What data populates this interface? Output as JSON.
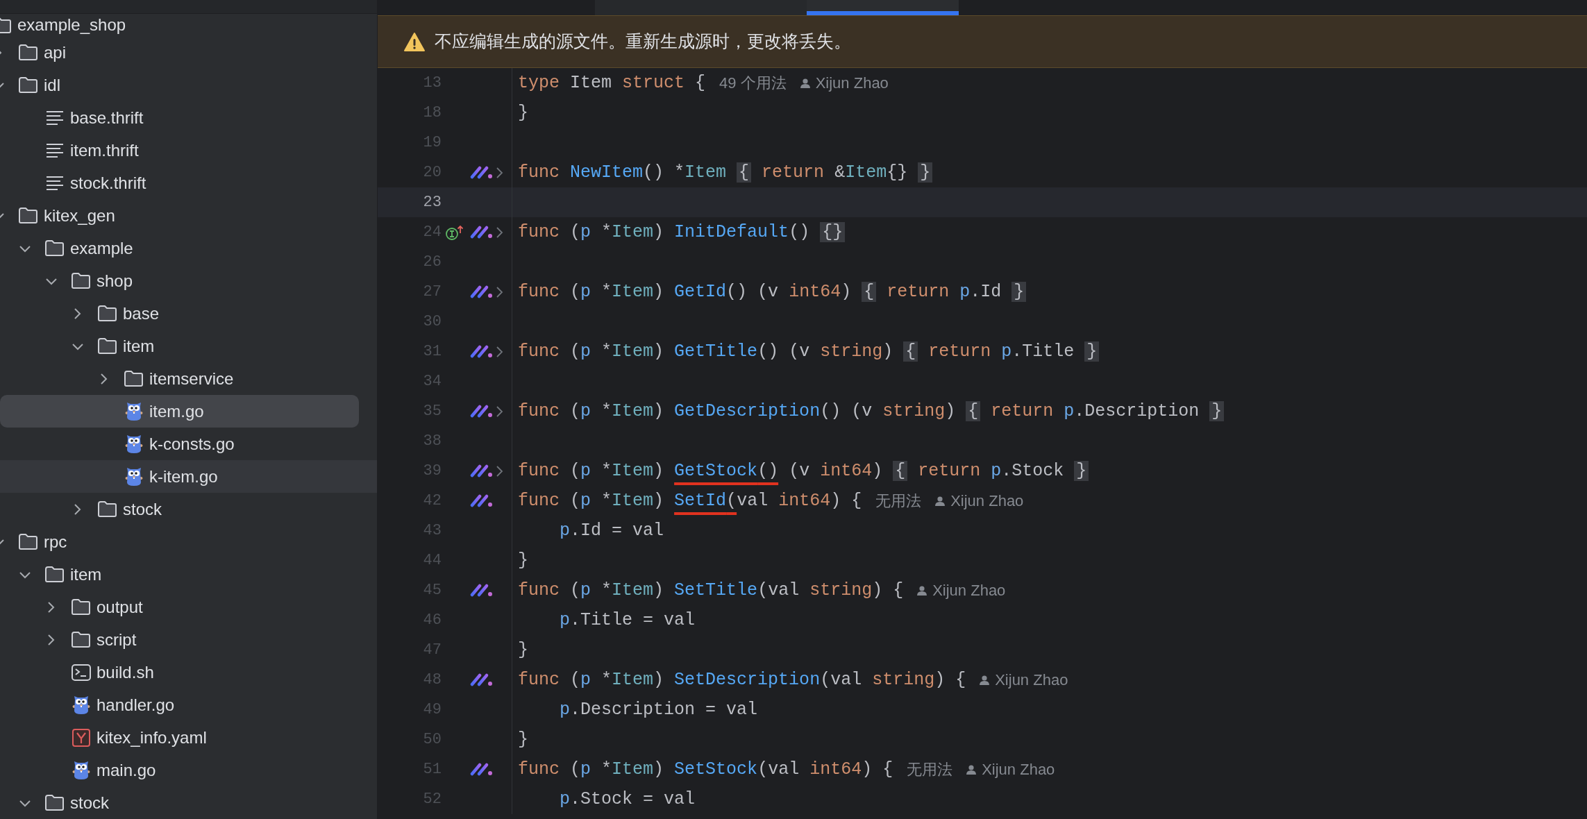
{
  "tree": [
    {
      "label": "example_shop",
      "kind": "folder",
      "selected": false,
      "hovered": false,
      "children": [
        {
          "label": "api",
          "kind": "folder",
          "expanded": false,
          "selected": false,
          "hovered": false
        },
        {
          "label": "idl",
          "kind": "folder",
          "expanded": true,
          "selected": false,
          "hovered": false,
          "children": [
            {
              "label": "base.thrift",
              "kind": "text",
              "selected": false,
              "hovered": false
            },
            {
              "label": "item.thrift",
              "kind": "text",
              "selected": false,
              "hovered": false
            },
            {
              "label": "stock.thrift",
              "kind": "text",
              "selected": false,
              "hovered": false
            }
          ]
        },
        {
          "label": "kitex_gen",
          "kind": "folder",
          "expanded": true,
          "selected": false,
          "hovered": false,
          "children": [
            {
              "label": "example",
              "kind": "folder",
              "expanded": true,
              "selected": false,
              "hovered": false,
              "children": [
                {
                  "label": "shop",
                  "kind": "folder",
                  "expanded": true,
                  "selected": false,
                  "hovered": false,
                  "children": [
                    {
                      "label": "base",
                      "kind": "folder",
                      "expanded": false,
                      "selected": false,
                      "hovered": false
                    },
                    {
                      "label": "item",
                      "kind": "folder",
                      "expanded": true,
                      "selected": false,
                      "hovered": false,
                      "children": [
                        {
                          "label": "itemservice",
                          "kind": "folder",
                          "expanded": false,
                          "selected": false,
                          "hovered": false
                        },
                        {
                          "label": "item.go",
                          "kind": "go",
                          "selected": true,
                          "hovered": false
                        },
                        {
                          "label": "k-consts.go",
                          "kind": "go",
                          "selected": false,
                          "hovered": false
                        },
                        {
                          "label": "k-item.go",
                          "kind": "go",
                          "selected": false,
                          "hovered": true
                        }
                      ]
                    },
                    {
                      "label": "stock",
                      "kind": "folder",
                      "expanded": false,
                      "selected": false,
                      "hovered": false
                    }
                  ]
                }
              ]
            }
          ]
        },
        {
          "label": "rpc",
          "kind": "folder",
          "expanded": true,
          "selected": false,
          "hovered": false,
          "children": [
            {
              "label": "item",
              "kind": "folder",
              "expanded": true,
              "selected": false,
              "hovered": false,
              "children": [
                {
                  "label": "output",
                  "kind": "folder",
                  "expanded": false,
                  "selected": false,
                  "hovered": false
                },
                {
                  "label": "script",
                  "kind": "folder",
                  "expanded": false,
                  "selected": false,
                  "hovered": false
                },
                {
                  "label": "build.sh",
                  "kind": "shell",
                  "selected": false,
                  "hovered": false
                },
                {
                  "label": "handler.go",
                  "kind": "go",
                  "selected": false,
                  "hovered": false
                },
                {
                  "label": "kitex_info.yaml",
                  "kind": "yaml",
                  "selected": false,
                  "hovered": false
                },
                {
                  "label": "main.go",
                  "kind": "go",
                  "selected": false,
                  "hovered": false
                }
              ]
            },
            {
              "label": "stock",
              "kind": "folder",
              "expanded": true,
              "selected": false,
              "hovered": false
            }
          ]
        }
      ]
    }
  ],
  "tabs": [
    {
      "selected": false
    },
    {
      "selected": true
    }
  ],
  "banner": {
    "message": "不应编辑生成的源文件。重新生成源时，更改将丢失。"
  },
  "lines": [
    {
      "number": "13",
      "current": false,
      "mark": false,
      "foldable": false,
      "interface": false,
      "tokens": [
        {
          "kind": "kw",
          "text": "type "
        },
        {
          "kind": "plain",
          "text": "Item "
        },
        {
          "kind": "kw",
          "text": "struct "
        },
        {
          "kind": "plain",
          "text": "{"
        }
      ],
      "hints": [
        {
          "kind": "usages",
          "text": "49 个用法"
        },
        {
          "kind": "author",
          "text": "Xijun Zhao"
        }
      ]
    },
    {
      "number": "18",
      "current": false,
      "mark": false,
      "foldable": false,
      "interface": false,
      "tokens": [
        {
          "kind": "plain",
          "text": "}"
        }
      ]
    },
    {
      "number": "19",
      "current": false,
      "mark": false,
      "foldable": false,
      "interface": false
    },
    {
      "number": "20",
      "current": false,
      "mark": true,
      "foldable": true,
      "interface": false,
      "tokens": [
        {
          "kind": "kw",
          "text": "func "
        },
        {
          "kind": "fn",
          "text": "NewItem"
        },
        {
          "kind": "plain",
          "text": "() *"
        },
        {
          "kind": "type",
          "text": "Item "
        },
        {
          "kind": "fold",
          "text": "{"
        },
        {
          "kind": "kw",
          "text": " return"
        },
        {
          "kind": "plain",
          "text": " &"
        },
        {
          "kind": "type",
          "text": "Item"
        },
        {
          "kind": "plain",
          "text": "{} "
        },
        {
          "kind": "fold",
          "text": "}"
        }
      ]
    },
    {
      "number": "23",
      "current": true,
      "mark": false,
      "foldable": false,
      "interface": false
    },
    {
      "number": "24",
      "current": false,
      "mark": true,
      "foldable": true,
      "interface": true,
      "tokens": [
        {
          "kind": "kw",
          "text": "func "
        },
        {
          "kind": "plain",
          "text": "("
        },
        {
          "kind": "param",
          "text": "p"
        },
        {
          "kind": "plain",
          "text": " *"
        },
        {
          "kind": "type",
          "text": "Item"
        },
        {
          "kind": "plain",
          "text": ") "
        },
        {
          "kind": "fn",
          "text": "InitDefault"
        },
        {
          "kind": "plain",
          "text": "() "
        },
        {
          "kind": "fold",
          "text": "{}"
        }
      ]
    },
    {
      "number": "26",
      "current": false,
      "mark": false,
      "foldable": false,
      "interface": false
    },
    {
      "number": "27",
      "current": false,
      "mark": true,
      "foldable": true,
      "interface": false,
      "tokens": [
        {
          "kind": "kw",
          "text": "func "
        },
        {
          "kind": "plain",
          "text": "("
        },
        {
          "kind": "param",
          "text": "p"
        },
        {
          "kind": "plain",
          "text": " *"
        },
        {
          "kind": "type",
          "text": "Item"
        },
        {
          "kind": "plain",
          "text": ") "
        },
        {
          "kind": "fn",
          "text": "GetId"
        },
        {
          "kind": "plain",
          "text": "() (v "
        },
        {
          "kind": "kw",
          "text": "int64"
        },
        {
          "kind": "plain",
          "text": ") "
        },
        {
          "kind": "fold",
          "text": "{"
        },
        {
          "kind": "kw",
          "text": " return "
        },
        {
          "kind": "param",
          "text": "p"
        },
        {
          "kind": "plain",
          "text": ".Id "
        },
        {
          "kind": "fold",
          "text": "}"
        }
      ]
    },
    {
      "number": "30",
      "current": false,
      "mark": false,
      "foldable": false,
      "interface": false
    },
    {
      "number": "31",
      "current": false,
      "mark": true,
      "foldable": true,
      "interface": false,
      "tokens": [
        {
          "kind": "kw",
          "text": "func "
        },
        {
          "kind": "plain",
          "text": "("
        },
        {
          "kind": "param",
          "text": "p"
        },
        {
          "kind": "plain",
          "text": " *"
        },
        {
          "kind": "type",
          "text": "Item"
        },
        {
          "kind": "plain",
          "text": ") "
        },
        {
          "kind": "fn",
          "text": "GetTitle"
        },
        {
          "kind": "plain",
          "text": "() (v "
        },
        {
          "kind": "kw",
          "text": "string"
        },
        {
          "kind": "plain",
          "text": ") "
        },
        {
          "kind": "fold",
          "text": "{"
        },
        {
          "kind": "kw",
          "text": " return "
        },
        {
          "kind": "param",
          "text": "p"
        },
        {
          "kind": "plain",
          "text": ".Title "
        },
        {
          "kind": "fold",
          "text": "}"
        }
      ]
    },
    {
      "number": "34",
      "current": false,
      "mark": false,
      "foldable": false,
      "interface": false
    },
    {
      "number": "35",
      "current": false,
      "mark": true,
      "foldable": true,
      "interface": false,
      "tokens": [
        {
          "kind": "kw",
          "text": "func "
        },
        {
          "kind": "plain",
          "text": "("
        },
        {
          "kind": "param",
          "text": "p"
        },
        {
          "kind": "plain",
          "text": " *"
        },
        {
          "kind": "type",
          "text": "Item"
        },
        {
          "kind": "plain",
          "text": ") "
        },
        {
          "kind": "fn",
          "text": "GetDescription"
        },
        {
          "kind": "plain",
          "text": "() (v "
        },
        {
          "kind": "kw",
          "text": "string"
        },
        {
          "kind": "plain",
          "text": ") "
        },
        {
          "kind": "fold",
          "text": "{"
        },
        {
          "kind": "kw",
          "text": " return "
        },
        {
          "kind": "param",
          "text": "p"
        },
        {
          "kind": "plain",
          "text": ".Description "
        },
        {
          "kind": "fold",
          "text": "}"
        }
      ]
    },
    {
      "number": "38",
      "current": false,
      "mark": false,
      "foldable": false,
      "interface": false
    },
    {
      "number": "39",
      "current": false,
      "mark": true,
      "foldable": true,
      "interface": false,
      "tokens": [
        {
          "kind": "kw",
          "text": "func "
        },
        {
          "kind": "plain",
          "text": "("
        },
        {
          "kind": "param",
          "text": "p"
        },
        {
          "kind": "plain",
          "text": " *"
        },
        {
          "kind": "type",
          "text": "Item"
        },
        {
          "kind": "plain",
          "text": ") "
        },
        {
          "kind": "marked",
          "tokens": [
            {
              "kind": "fn",
              "text": "GetStock"
            },
            {
              "kind": "plain",
              "text": "()"
            }
          ]
        },
        {
          "kind": "plain",
          "text": " (v "
        },
        {
          "kind": "kw",
          "text": "int64"
        },
        {
          "kind": "plain",
          "text": ") "
        },
        {
          "kind": "fold",
          "text": "{"
        },
        {
          "kind": "kw",
          "text": " return "
        },
        {
          "kind": "param",
          "text": "p"
        },
        {
          "kind": "plain",
          "text": ".Stock "
        },
        {
          "kind": "fold",
          "text": "}"
        }
      ]
    },
    {
      "number": "42",
      "current": false,
      "mark": true,
      "foldable": false,
      "interface": false,
      "tokens": [
        {
          "kind": "kw",
          "text": "func "
        },
        {
          "kind": "plain",
          "text": "("
        },
        {
          "kind": "param",
          "text": "p"
        },
        {
          "kind": "plain",
          "text": " *"
        },
        {
          "kind": "type",
          "text": "Item"
        },
        {
          "kind": "plain",
          "text": ") "
        },
        {
          "kind": "marked",
          "tokens": [
            {
              "kind": "fn",
              "text": "SetId"
            },
            {
              "kind": "plain",
              "text": "("
            }
          ]
        },
        {
          "kind": "plain",
          "text": "val "
        },
        {
          "kind": "kw",
          "text": "int64"
        },
        {
          "kind": "plain",
          "text": ") {"
        }
      ],
      "hints": [
        {
          "kind": "usages",
          "text": "无用法"
        },
        {
          "kind": "author",
          "text": "Xijun Zhao"
        }
      ]
    },
    {
      "number": "43",
      "current": false,
      "mark": false,
      "foldable": false,
      "interface": false,
      "tokens": [
        {
          "kind": "param",
          "text": "    p"
        },
        {
          "kind": "plain",
          "text": ".Id = val"
        }
      ]
    },
    {
      "number": "44",
      "current": false,
      "mark": false,
      "foldable": false,
      "interface": false,
      "tokens": [
        {
          "kind": "plain",
          "text": "}"
        }
      ]
    },
    {
      "number": "45",
      "current": false,
      "mark": true,
      "foldable": false,
      "interface": false,
      "tokens": [
        {
          "kind": "kw",
          "text": "func "
        },
        {
          "kind": "plain",
          "text": "("
        },
        {
          "kind": "param",
          "text": "p"
        },
        {
          "kind": "plain",
          "text": " *"
        },
        {
          "kind": "type",
          "text": "Item"
        },
        {
          "kind": "plain",
          "text": ") "
        },
        {
          "kind": "fn",
          "text": "SetTitle"
        },
        {
          "kind": "plain",
          "text": "(val "
        },
        {
          "kind": "kw",
          "text": "string"
        },
        {
          "kind": "plain",
          "text": ") {"
        }
      ],
      "hints": [
        {
          "kind": "author",
          "text": "Xijun Zhao"
        }
      ]
    },
    {
      "number": "46",
      "current": false,
      "mark": false,
      "foldable": false,
      "interface": false,
      "tokens": [
        {
          "kind": "param",
          "text": "    p"
        },
        {
          "kind": "plain",
          "text": ".Title = val"
        }
      ]
    },
    {
      "number": "47",
      "current": false,
      "mark": false,
      "foldable": false,
      "interface": false,
      "tokens": [
        {
          "kind": "plain",
          "text": "}"
        }
      ]
    },
    {
      "number": "48",
      "current": false,
      "mark": true,
      "foldable": false,
      "interface": false,
      "tokens": [
        {
          "kind": "kw",
          "text": "func "
        },
        {
          "kind": "plain",
          "text": "("
        },
        {
          "kind": "param",
          "text": "p"
        },
        {
          "kind": "plain",
          "text": " *"
        },
        {
          "kind": "type",
          "text": "Item"
        },
        {
          "kind": "plain",
          "text": ") "
        },
        {
          "kind": "fn",
          "text": "SetDescription"
        },
        {
          "kind": "plain",
          "text": "(val "
        },
        {
          "kind": "kw",
          "text": "string"
        },
        {
          "kind": "plain",
          "text": ") {"
        }
      ],
      "hints": [
        {
          "kind": "author",
          "text": "Xijun Zhao"
        }
      ]
    },
    {
      "number": "49",
      "current": false,
      "mark": false,
      "foldable": false,
      "interface": false,
      "tokens": [
        {
          "kind": "param",
          "text": "    p"
        },
        {
          "kind": "plain",
          "text": ".Description = val"
        }
      ]
    },
    {
      "number": "50",
      "current": false,
      "mark": false,
      "foldable": false,
      "interface": false,
      "tokens": [
        {
          "kind": "plain",
          "text": "}"
        }
      ]
    },
    {
      "number": "51",
      "current": false,
      "mark": true,
      "foldable": false,
      "interface": false,
      "tokens": [
        {
          "kind": "kw",
          "text": "func "
        },
        {
          "kind": "plain",
          "text": "("
        },
        {
          "kind": "param",
          "text": "p"
        },
        {
          "kind": "plain",
          "text": " *"
        },
        {
          "kind": "type",
          "text": "Item"
        },
        {
          "kind": "plain",
          "text": ") "
        },
        {
          "kind": "fn",
          "text": "SetStock"
        },
        {
          "kind": "plain",
          "text": "(val "
        },
        {
          "kind": "kw",
          "text": "int64"
        },
        {
          "kind": "plain",
          "text": ") {"
        }
      ],
      "hints": [
        {
          "kind": "usages",
          "text": "无用法"
        },
        {
          "kind": "author",
          "text": "Xijun Zhao"
        }
      ]
    },
    {
      "number": "52",
      "current": false,
      "mark": false,
      "foldable": false,
      "interface": false,
      "tokens": [
        {
          "kind": "param",
          "text": "    p"
        },
        {
          "kind": "plain",
          "text": ".Stock = val"
        }
      ]
    }
  ]
}
